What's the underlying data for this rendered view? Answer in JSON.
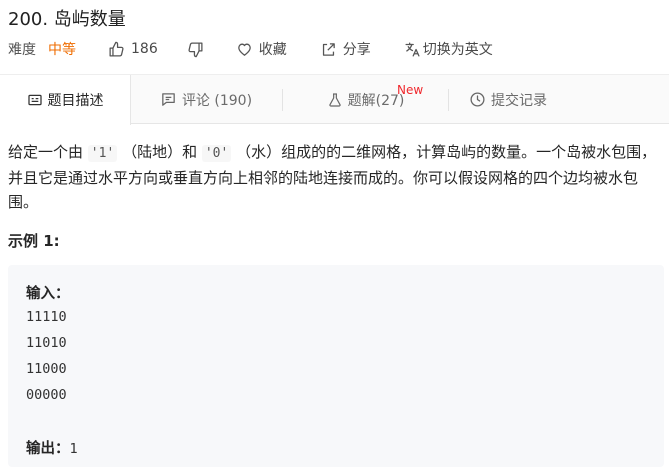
{
  "problem": {
    "title": "200. 岛屿数量"
  },
  "meta": {
    "difficulty_label": "难度",
    "difficulty_value": "中等",
    "likes": "186",
    "favorite_label": "收藏",
    "share_label": "分享",
    "translate_label": "切换为英文",
    "difficulty_color": "#ef6c00"
  },
  "tabs": [
    {
      "label": "题目描述",
      "icon": "description-icon"
    },
    {
      "label": "评论 (190)",
      "icon": "comment-icon"
    },
    {
      "label": "题解(27)",
      "icon": "flask-icon",
      "badge": "New"
    },
    {
      "label": "提交记录",
      "icon": "clock-icon"
    }
  ],
  "description": {
    "part1": "给定一个由",
    "code1": "'1'",
    "part2": "（陆地）和",
    "code2": "'0'",
    "part3": "（水）组成的的二维网格，计算岛屿的数量。一个岛被水包围，并且它是通过水平方向或垂直方向上相邻的陆地连接而成的。你可以假设网格的四个边均被水包围。"
  },
  "example": {
    "title": "示例 1:",
    "input_label": "输入：",
    "grid": [
      "11110",
      "11010",
      "11000",
      "00000"
    ],
    "output_label": "输出：",
    "output_value": "1"
  }
}
